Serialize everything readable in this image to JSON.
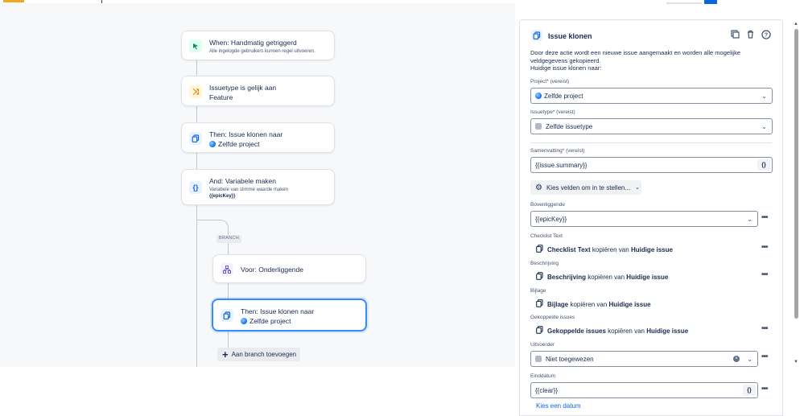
{
  "flow": {
    "trigger": {
      "title": "When: Handmatig getriggerd",
      "subtitle": "Alle ingelogde gebruikers kunnen regel uitvoeren."
    },
    "condition": {
      "title": "Issuetype is gelijk aan",
      "subtitle": "Feature"
    },
    "action1": {
      "title": "Then: Issue klonen naar",
      "subtitle": "Zelfde project"
    },
    "action2": {
      "title": "And: Variabele maken",
      "subtitle": "Variabele van slimme waarde maken",
      "value": "{{epicKey}}"
    },
    "branch_label": "BRANCH",
    "branch_node": {
      "title": "Voor: Onderliggende"
    },
    "branch_action": {
      "title": "Then: Issue klonen naar",
      "subtitle": "Zelfde project"
    },
    "add_branch": "Aan branch toevoegen"
  },
  "panel": {
    "title": "Issue klonen",
    "description": "Door deze actie wordt een nieuwe issue aangemaakt en worden alle mogelijke veldgegevens gekopieerd.",
    "clone_to": "Huidige issue klonen naar:",
    "project": {
      "label": "Project",
      "required": "(vereist)",
      "value": "Zelfde project"
    },
    "issuetype": {
      "label": "Issuetype",
      "required": "(vereist)",
      "value": "Zelfde issuetype"
    },
    "summary": {
      "label": "Samenvatting",
      "required": "(vereist)",
      "value": "{{issue.summary}}"
    },
    "choose_fields": "Kies velden om in te stellen...",
    "parent": {
      "label": "Bovenliggende",
      "value": "{{epicKey}}"
    },
    "copy_fields": [
      {
        "label": "Checklist Text",
        "field": "Checklist Text",
        "verb": "kopiëren van",
        "source": "Huidige issue"
      },
      {
        "label": "Beschrijving",
        "field": "Beschrijving",
        "verb": "kopiëren van",
        "source": "Huidige issue"
      },
      {
        "label": "Bijlage",
        "field": "Bijlage",
        "verb": "kopiëren van",
        "source": "Huidige issue"
      },
      {
        "label": "Gekoppelde issues",
        "field": "Gekoppelde issues",
        "verb": "kopiëren van",
        "source": "Huidige issue"
      }
    ],
    "assignee": {
      "label": "Uitvoerder",
      "value": "Niet toegewezen"
    },
    "duedate": {
      "label": "Einddatum",
      "value": "{{clear}}"
    },
    "pick_date": "Kies een datum",
    "brace_icon": "{}"
  },
  "colors": {
    "accent": "#0c66e4",
    "trigger_icon_bg": "#dcfff1",
    "condition_icon_bg": "#fff7d6",
    "action_icon_bg": "#e9f2ff",
    "branch_icon_bg": "#f3f0ff",
    "selected_border": "#388bff"
  }
}
